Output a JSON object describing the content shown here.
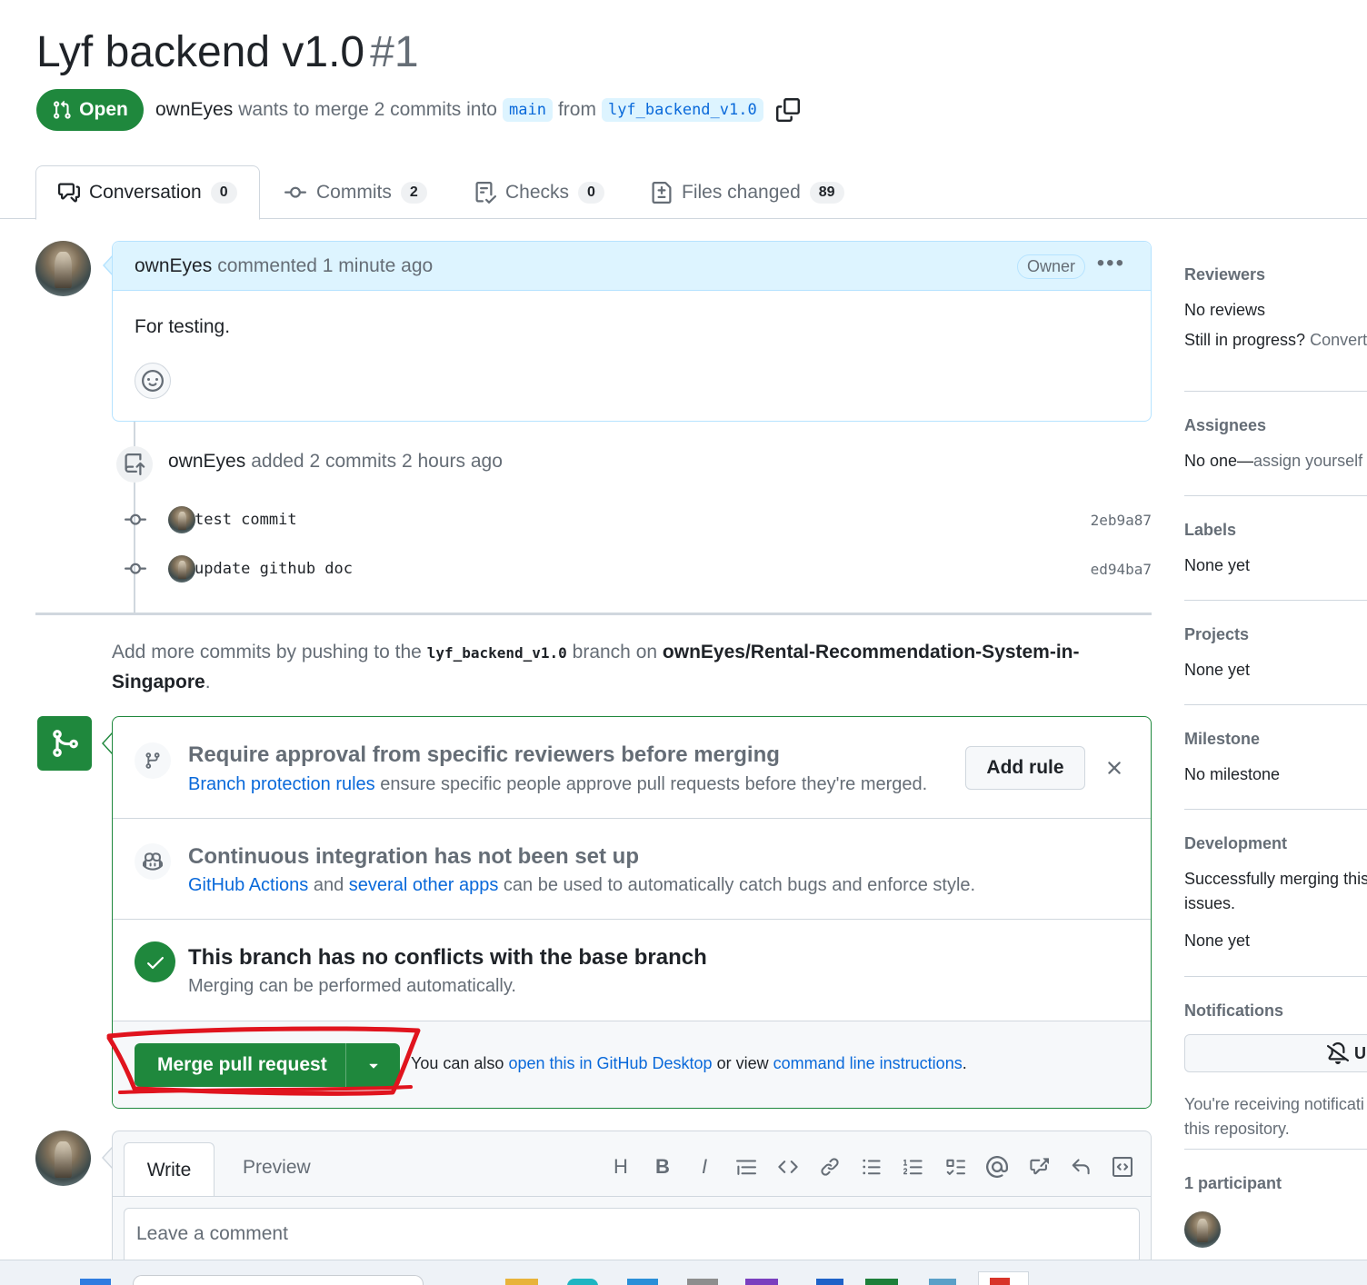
{
  "pr": {
    "title": "Lyf backend v1.0",
    "number": "#1",
    "state": "Open",
    "author": "ownEyes",
    "merge_text": "wants to merge 2 commits into",
    "base": "main",
    "from_text": "from",
    "head": "lyf_backend_v1.0"
  },
  "tabs": [
    {
      "label": "Conversation",
      "count": "0"
    },
    {
      "label": "Commits",
      "count": "2"
    },
    {
      "label": "Checks",
      "count": "0"
    },
    {
      "label": "Files changed",
      "count": "89"
    }
  ],
  "comment": {
    "author": "ownEyes",
    "meta": "commented 1 minute ago",
    "badge": "Owner",
    "body": "For testing."
  },
  "timeline": {
    "push_author": "ownEyes",
    "push_text": "added 2 commits 2 hours ago",
    "commits": [
      {
        "message": "test commit",
        "sha": "2eb9a87"
      },
      {
        "message": "update github doc",
        "sha": "ed94ba7"
      }
    ]
  },
  "push_hint": {
    "prefix": "Add more commits by pushing to the",
    "branch": "lyf_backend_v1.0",
    "middle": "branch on",
    "repo": "ownEyes/Rental-Recommendation-System-in-Singapore",
    "suffix": "."
  },
  "merge": {
    "rule_title": "Require approval from specific reviewers before merging",
    "rule_link": "Branch protection rules",
    "rule_text": "ensure specific people approve pull requests before they're merged.",
    "add_rule": "Add rule",
    "ci_title": "Continuous integration has not been set up",
    "ci_link1": "GitHub Actions",
    "ci_and": "and",
    "ci_link2": "several other apps",
    "ci_text": "can be used to automatically catch bugs and enforce style.",
    "ok_title": "This branch has no conflicts with the base branch",
    "ok_text": "Merging can be performed automatically.",
    "button": "Merge pull request",
    "alt_prefix": "You can also",
    "alt_link1": "open this in GitHub Desktop",
    "alt_mid": "or view",
    "alt_link2": "command line instructions",
    "alt_suffix": "."
  },
  "editor": {
    "write": "Write",
    "preview": "Preview",
    "placeholder": "Leave a comment",
    "tools": [
      "H",
      "B",
      "I"
    ]
  },
  "sidebar": {
    "reviewers_head": "Reviewers",
    "reviewers_value": "No reviews",
    "reviewers_extra": "Still in progress?",
    "reviewers_link": "Convert",
    "assignees_head": "Assignees",
    "assignees_value": "No one—",
    "assignees_link": "assign yourself",
    "labels_head": "Labels",
    "labels_value": "None yet",
    "projects_head": "Projects",
    "projects_value": "None yet",
    "milestone_head": "Milestone",
    "milestone_value": "No milestone",
    "development_head": "Development",
    "development_text1": "Successfully merging this",
    "development_text2": "issues.",
    "development_value": "None yet",
    "notifications_head": "Notifications",
    "notifications_button": "Ur",
    "notifications_text1": "You're receiving notificati",
    "notifications_text2": "this repository.",
    "participants_head": "1 participant"
  },
  "colors": {
    "accent_green": "#1f883d",
    "link_blue": "#0969da",
    "annotation_red": "#e0141e"
  }
}
